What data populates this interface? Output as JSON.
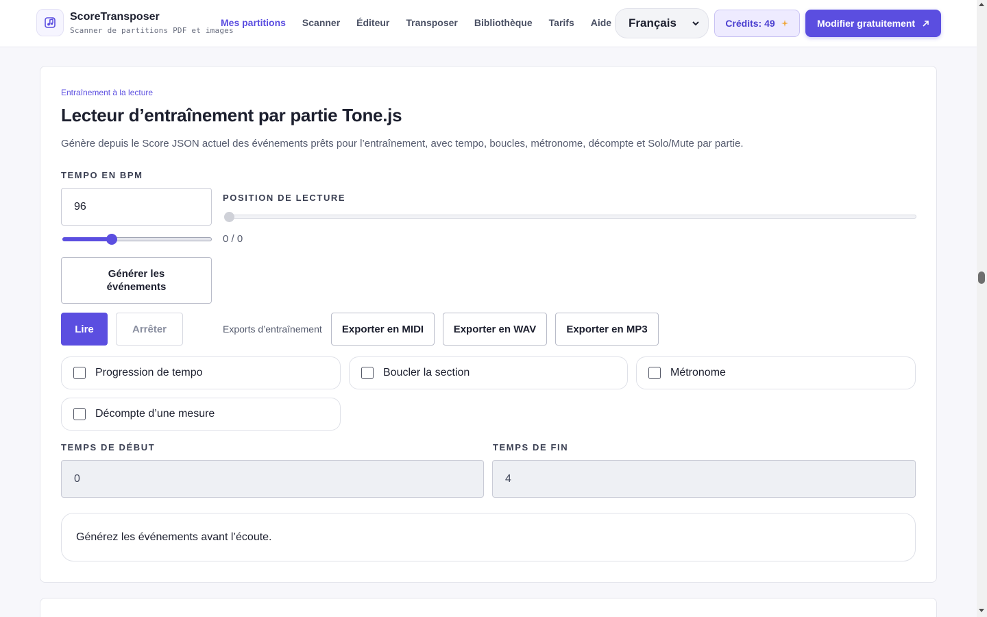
{
  "header": {
    "brand_name": "ScoreTransposer",
    "brand_subtitle": "Scanner de partitions PDF et images",
    "nav": [
      {
        "label": "Mes partitions",
        "active": true
      },
      {
        "label": "Scanner",
        "active": false
      },
      {
        "label": "Éditeur",
        "active": false
      },
      {
        "label": "Transposer",
        "active": false
      },
      {
        "label": "Bibliothèque",
        "active": false
      },
      {
        "label": "Tarifs",
        "active": false
      },
      {
        "label": "Aide",
        "active": false
      }
    ],
    "language": "Français",
    "credits_label": "Crédits: 49",
    "cta_label": "Modifier gratuitement"
  },
  "practice": {
    "eyebrow": "Entraînement à la lecture",
    "title": "Lecteur d’entraînement par partie Tone.js",
    "description": "Génère depuis le Score JSON actuel des événements prêts pour l’entraînement, avec tempo, boucles, métronome, décompte et Solo/Mute par partie.",
    "tempo_label": "TEMPO EN BPM",
    "tempo_value": "96",
    "tempo_slider_fraction": 0.33,
    "position_label": "POSITION DE LECTURE",
    "position_readout": "0 / 0",
    "position_fraction": 0,
    "generate_label": "Générer les événements",
    "play_label": "Lire",
    "stop_label": "Arrêter",
    "exports_label": "Exports d’entraînement",
    "export_midi": "Exporter en MIDI",
    "export_wav": "Exporter en WAV",
    "export_mp3": "Exporter en MP3",
    "options": [
      {
        "label": "Progression de tempo",
        "checked": false
      },
      {
        "label": "Boucler la section",
        "checked": false
      },
      {
        "label": "Métronome",
        "checked": false
      },
      {
        "label": "Décompte d’une mesure",
        "checked": false
      }
    ],
    "start_label": "TEMPS DE DÉBUT",
    "start_value": "0",
    "end_label": "TEMPS DE FIN",
    "end_value": "4",
    "status_message": "Générez les événements avant l’écoute."
  },
  "colors": {
    "accent": "#5b4ee0",
    "accent_light": "#eeebff",
    "spark": "#f0a63a"
  }
}
